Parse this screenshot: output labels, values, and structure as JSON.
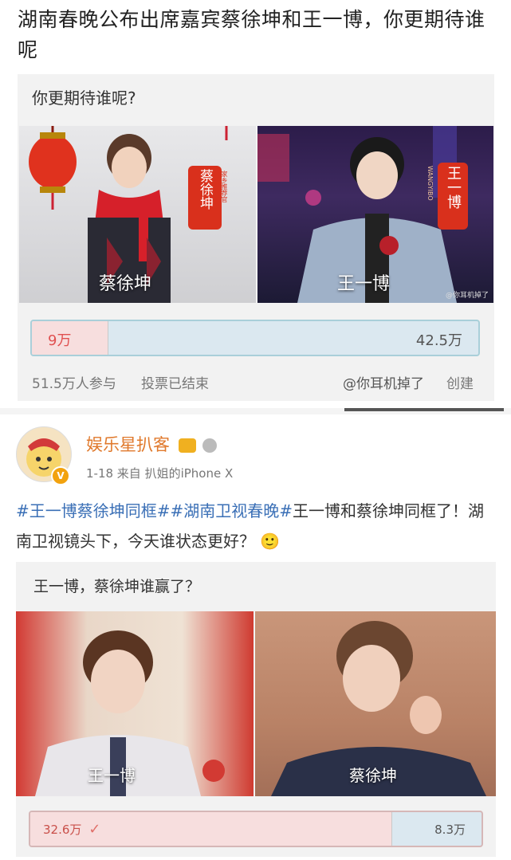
{
  "headline": "湖南春晚公布出席嘉宾蔡徐坤和王一博，你更期待谁呢",
  "poll1": {
    "question": "你更期待谁呢?",
    "left": {
      "caption": "蔡徐坤",
      "badge_name": "蔡徐坤",
      "badge_sub": "家乡推荐官",
      "value": "9万",
      "fraction": 0.17
    },
    "right": {
      "caption": "王一博",
      "badge_name": "王一博",
      "badge_sub": "WANGYIBO",
      "value": "42.5万",
      "watermark": "@你耳机掉了"
    },
    "participants": "51.5万人参与",
    "status": "投票已结束",
    "creator": "@你耳机掉了",
    "create_label": "创建"
  },
  "post": {
    "username": "娱乐星扒客",
    "meta": "1-18  来自 扒姐的iPhone X",
    "tags": [
      "#王一博蔡徐坤同框#",
      "#湖南卫视春晚#"
    ],
    "body": "王一博和蔡徐坤同框了！湖南卫视镜头下，今天谁状态更好？",
    "emoji": "🙂"
  },
  "poll2": {
    "question": "王一博，蔡徐坤谁赢了？",
    "left": {
      "caption": "王一博",
      "value": "32.6万",
      "fraction": 0.8
    },
    "right": {
      "caption": "蔡徐坤",
      "value": "8.3万"
    }
  },
  "colors": {
    "accent": "#e0792c",
    "link": "#3a6fb6",
    "vote_left": "#f7dede",
    "vote_right": "#dbe8f0",
    "badge_red": "#d9301c"
  }
}
